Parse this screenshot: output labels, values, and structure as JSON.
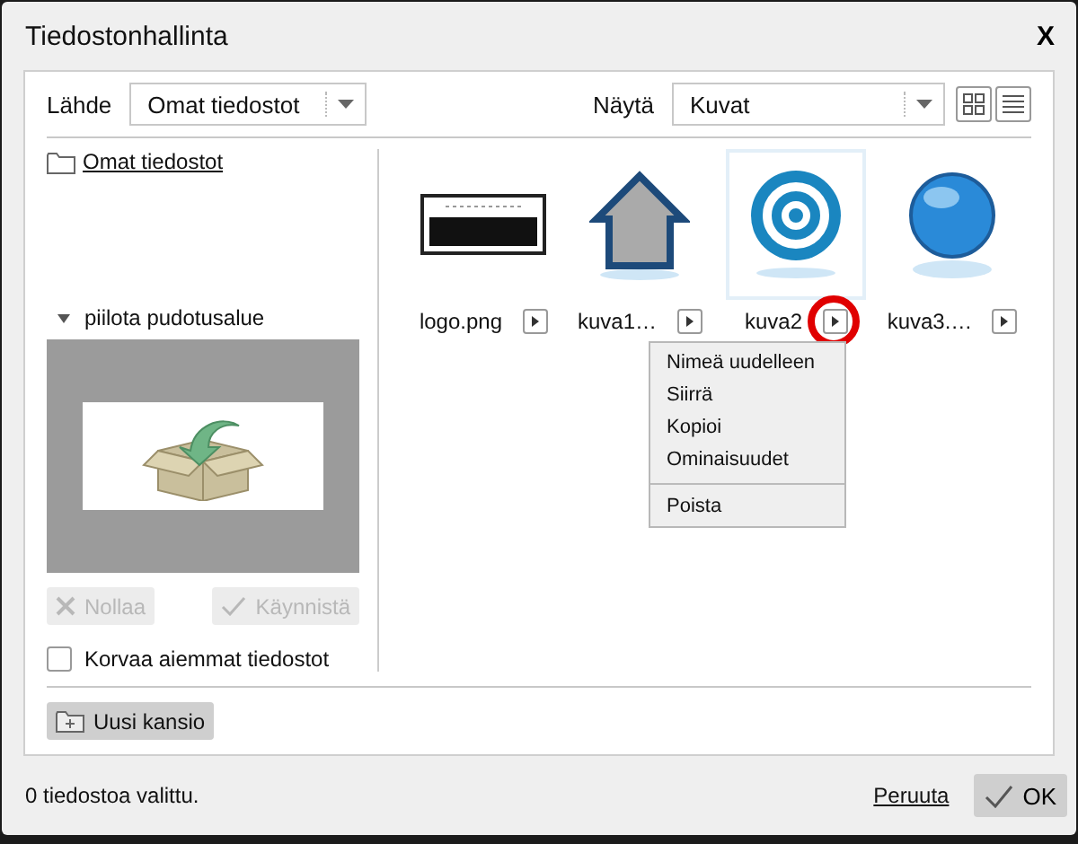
{
  "window": {
    "title": "Tiedostonhallinta",
    "close": "X"
  },
  "toolbar": {
    "source_label": "Lähde",
    "source_select": "Omat tiedostot",
    "view_label": "Näytä",
    "view_select": "Kuvat"
  },
  "sidebar": {
    "folder": "Omat tiedostot",
    "drop_toggle": "piilota pudotusalue",
    "drop_expanded": true,
    "buttons": [
      {
        "label": "Nollaa",
        "kind": "reset",
        "disabled": true
      },
      {
        "label": "Käynnistä",
        "kind": "start",
        "disabled": true
      }
    ],
    "overwrite": {
      "label": "Korvaa aiemmat tiedostot",
      "checked": false
    }
  },
  "files": [
    {
      "name": "logo.png",
      "kind": "logo",
      "selected": false
    },
    {
      "name": "kuva1…",
      "kind": "house",
      "selected": false
    },
    {
      "name": "kuva2",
      "kind": "at",
      "selected": true
    },
    {
      "name": "kuva3.…",
      "kind": "globe",
      "selected": false
    }
  ],
  "context_menu": [
    {
      "label": "Nimeä uudelleen",
      "separator_before": false
    },
    {
      "label": "Siirrä",
      "separator_before": false
    },
    {
      "label": "Kopioi",
      "separator_before": false
    },
    {
      "label": "Ominaisuudet",
      "separator_before": false
    },
    {
      "label": "Poista",
      "separator_before": true
    }
  ],
  "new_folder": "Uusi kansio",
  "status_bar": {
    "text": "0 tiedostoa valittu.",
    "cancel": "Peruuta",
    "ok": "OK"
  }
}
